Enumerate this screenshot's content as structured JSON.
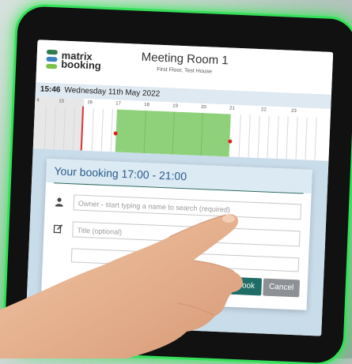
{
  "brand": {
    "name_line1": "matrix",
    "name_line2": "booking",
    "colors": [
      "#2e7d4f",
      "#3b82c4",
      "#7cc24a"
    ]
  },
  "room": {
    "title": "Meeting Room 1",
    "subtitle": "First Floor, Test House"
  },
  "datebar": {
    "time": "15:46",
    "date": "Wednesday 11th May 2022"
  },
  "timeline": {
    "hours": [
      "4",
      "15",
      "16",
      "17",
      "18",
      "19",
      "20",
      "21",
      "22",
      "23"
    ],
    "booking_color": "#8fd17b"
  },
  "dialog": {
    "title": "Your booking 17:00 - 21:00",
    "owner_placeholder": "Owner - start typing a name to search (required)",
    "title_placeholder": "Title (optional)",
    "book_label": "Book",
    "cancel_label": "Cancel"
  },
  "accent": {
    "glow": "#34e05a",
    "primary_button": "#1f6d66"
  }
}
